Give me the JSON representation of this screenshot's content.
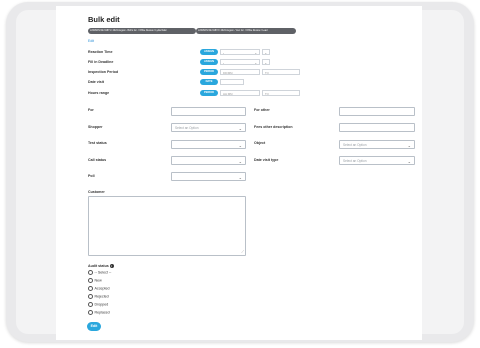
{
  "title": "Bulk edit",
  "chips": [
    "LAWSON NE 61871 / 2024 August - Bob's Inc. / Office Review / Lydia Nabc",
    "LAWSON NE 61872 / 2024 August - Your Inc. / Office Review / Lead"
  ],
  "edit_link": "Edit",
  "left_settings": [
    {
      "label": "Reaction Time",
      "pill": "ASSIGN",
      "type": "pair-select",
      "v1": "-",
      "v2": "-"
    },
    {
      "label": "Fill in Deadline",
      "pill": "ASSIGN",
      "type": "pair-select",
      "v1": "-",
      "v2": "-"
    },
    {
      "label": "Inspection Period",
      "pill": "PERIOD",
      "type": "pair-input",
      "v1": "DD/MM",
      "v2": "TO"
    },
    {
      "label": "Date visit",
      "pill": "DATE",
      "type": "single-input",
      "v1": ""
    },
    {
      "label": "Hours range",
      "pill": "PERIOD",
      "type": "pair-input",
      "v1": "HH:MM",
      "v2": "TO"
    }
  ],
  "form": {
    "for_label": "For",
    "for_other_label": "For other",
    "shopper_label": "Shopper",
    "shopper_placeholder": "Select an Option",
    "for_other_description_label": "Fees other description",
    "test_status_label": "Test status",
    "object_label": "Object",
    "object_placeholder": "Select an Option",
    "call_status_label": "Call status",
    "date_visit_type_label": "Date visit type",
    "date_visit_type_placeholder": "Select an Option",
    "poll_label": "Poll",
    "customer_label": "Customer"
  },
  "audit": {
    "label": "Audit status",
    "info_icon": "info-icon",
    "options": [
      "-- Select --",
      "New",
      "Accepted",
      "Rejected",
      "Dropped",
      "Replaced"
    ]
  },
  "edit_button": "Edit",
  "colors": {
    "accent": "#2aa7dd",
    "chip": "#5f6166",
    "frame": "#e9e9eb"
  }
}
